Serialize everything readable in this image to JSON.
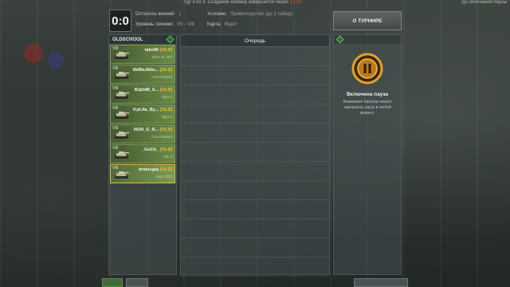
{
  "topbar": {
    "round_text": "Тур 3 из 3. Создание команд завершится через",
    "round_timer": "17:59",
    "right_text": "До окончания паузы"
  },
  "score": "0:0",
  "info": {
    "lives_label": "Осталось жизней:",
    "lives_value": "1",
    "tier_label": "Уровень техники:",
    "tier_value": "VII - VIII",
    "condition_label": "Условие:",
    "condition_value": "Превосходство (до 2 побед)",
    "map_label": "Карта:",
    "map_value": "Фауст"
  },
  "team": {
    "name": "OLDSCHOOL",
    "players": [
      {
        "tier": "VIII",
        "name": "tako95",
        "tag": "[OLS]",
        "vehicle": "Rhm.-B. WT",
        "active": false
      },
      {
        "tier": "VIII",
        "name": "6blBaJIblu...",
        "tag": "[OLS]",
        "vehicle": "P.44 Pantera",
        "active": false
      },
      {
        "tier": "VIII",
        "name": "B3pbIB_b...",
        "tag": "[OLS]",
        "vehicle": "Tiger II",
        "active": false
      },
      {
        "tier": "VIII",
        "name": "KykJIa_By...",
        "tag": "[OLS]",
        "vehicle": "Tiger II",
        "active": false
      },
      {
        "tier": "VIII",
        "name": "NON_G_R...",
        "tag": "[OLS]",
        "vehicle": "P.44 Pantera",
        "active": false
      },
      {
        "tier": "VIII",
        "name": "_GoCb_",
        "tag": "[OLS]",
        "vehicle": "ИС-3",
        "active": false
      },
      {
        "tier": "VIII",
        "name": "dnduogiq",
        "tag": "[OLS]",
        "vehicle": "AMX CDC",
        "active": true
      }
    ]
  },
  "queue": {
    "title": "Очередь"
  },
  "tournament": {
    "about_button": "О ТУРНИРЕ",
    "pause_title": "Включена пауза",
    "pause_desc": "Внимание! Капитан может завершить паузу в любой момент."
  },
  "colors": {
    "accent_green": "#4fd04a",
    "clan_tag": "#f0c040",
    "pause_orange": "#e8a020",
    "timer_red": "#e05040"
  }
}
